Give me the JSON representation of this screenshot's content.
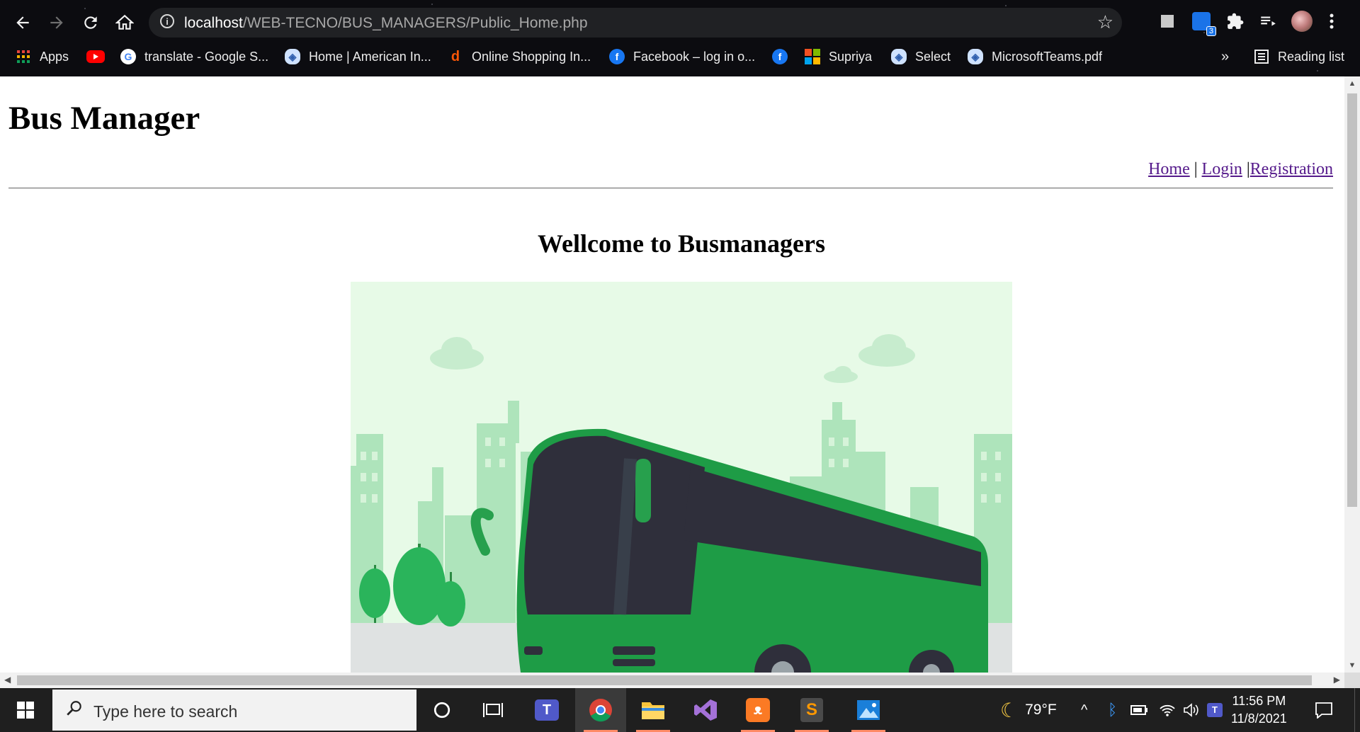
{
  "browser": {
    "url_host": "localhost",
    "url_path": "/WEB-TECNO/BUS_MANAGERS/Public_Home.php",
    "extension_badge": "3",
    "bookmarks": [
      {
        "label": "Apps",
        "icon": "apps-grid-icon"
      },
      {
        "label": "",
        "icon": "youtube-icon"
      },
      {
        "label": "translate - Google S...",
        "icon": "google-icon"
      },
      {
        "label": "Home | American In...",
        "icon": "shield-favicon-icon"
      },
      {
        "label": "Online Shopping In...",
        "icon": "daraz-icon"
      },
      {
        "label": "Facebook – log in o...",
        "icon": "facebook-icon"
      },
      {
        "label": "",
        "icon": "facebook-icon"
      },
      {
        "label": "Supriya",
        "icon": "microsoft-icon"
      },
      {
        "label": "Select",
        "icon": "shield-favicon-icon"
      },
      {
        "label": "MicrosoftTeams.pdf",
        "icon": "shield-favicon-icon"
      }
    ],
    "overflow_label": "»",
    "reading_list_label": "Reading list"
  },
  "page": {
    "site_title": "Bus Manager",
    "nav": {
      "home": "Home",
      "separator1": "|",
      "login": "Login",
      "separator2": "|",
      "registration": "Registration"
    },
    "welcome_heading": "Wellcome to Busmanagers"
  },
  "taskbar": {
    "search_placeholder": "Type here to search",
    "weather_temp": "79°F",
    "time": "11:56 PM",
    "date": "11/8/2021"
  },
  "colors": {
    "bus_green": "#1e9c46",
    "bus_dark": "#2f2f3b",
    "sky": "#e6f9e6",
    "city": "#a9e2b5",
    "link_visited": "#551a8b"
  }
}
